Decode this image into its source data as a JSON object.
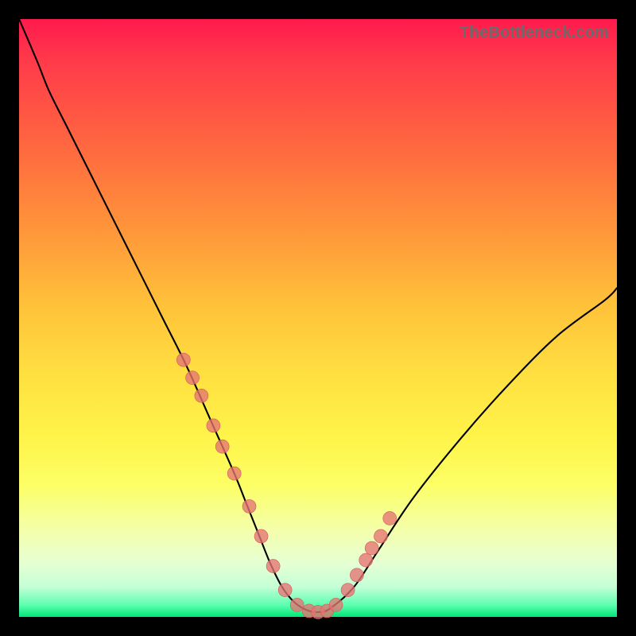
{
  "watermark": "TheBottleneck.com",
  "chart_data": {
    "type": "line",
    "title": "",
    "xlabel": "",
    "ylabel": "",
    "ylim": [
      0,
      100
    ],
    "xlim": [
      0,
      100
    ],
    "series": [
      {
        "name": "bottleneck-curve",
        "x": [
          0,
          3,
          5,
          8,
          12,
          16,
          20,
          24,
          28,
          32,
          36,
          38,
          40,
          42,
          44,
          46,
          48,
          50,
          52,
          56,
          60,
          66,
          74,
          82,
          90,
          98,
          100
        ],
        "y": [
          100,
          93,
          88,
          82,
          74,
          66,
          58,
          50,
          42,
          33,
          24,
          19,
          14,
          9,
          5,
          2.5,
          1.2,
          0.8,
          1.4,
          5,
          11,
          20,
          30,
          39,
          47,
          53,
          55
        ]
      }
    ],
    "markers": {
      "name": "highlighted-points",
      "x": [
        27.5,
        29.0,
        30.5,
        32.5,
        34.0,
        36.0,
        38.5,
        40.5,
        42.5,
        44.5,
        46.5,
        48.5,
        50.0,
        51.5,
        53.0,
        55.0,
        56.5,
        58.0,
        59.0,
        60.5,
        62.0
      ],
      "y": [
        43,
        40,
        37,
        32,
        28.5,
        24,
        18.5,
        13.5,
        8.5,
        4.5,
        2.0,
        1.0,
        0.8,
        1.0,
        2.0,
        4.5,
        7.0,
        9.5,
        11.5,
        13.5,
        16.5
      ]
    },
    "colors": {
      "gradient_top": "#ff1a4d",
      "gradient_mid": "#ffe141",
      "gradient_bottom": "#00e676",
      "curve": "#000000",
      "marker": "#e57373"
    }
  }
}
